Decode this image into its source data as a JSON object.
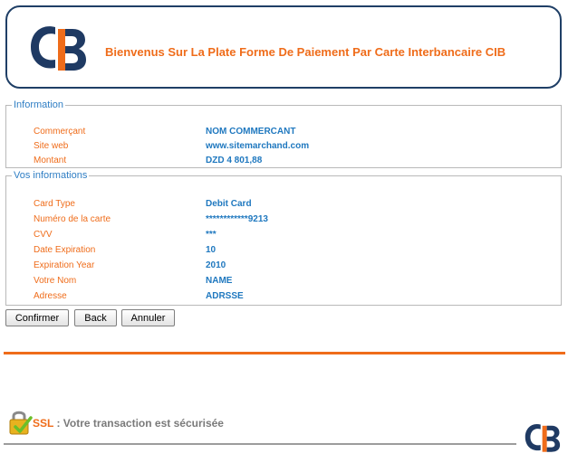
{
  "header": {
    "logo_text": "CIB",
    "welcome": "Bienvenus Sur La Plate Forme De Paiement Par Carte Interbancaire CIB"
  },
  "information": {
    "legend": "Information",
    "rows": [
      {
        "label": "Commerçant",
        "value": "NOM COMMERCANT"
      },
      {
        "label": "Site web",
        "value": "www.sitemarchand.com"
      },
      {
        "label": "Montant",
        "value": "DZD  4 801,88"
      }
    ]
  },
  "vos_informations": {
    "legend": "Vos informations",
    "rows": [
      {
        "label": "Card Type",
        "value": "Debit Card"
      },
      {
        "label": "Numéro de la carte",
        "value": "************9213"
      },
      {
        "label": "CVV",
        "value": "***"
      },
      {
        "label": "Date Expiration",
        "value": "10"
      },
      {
        "label": "Expiration Year",
        "value": "2010"
      },
      {
        "label": "Votre Nom",
        "value": "NAME"
      },
      {
        "label": "Adresse",
        "value": "ADRSSE"
      }
    ]
  },
  "buttons": {
    "confirm": "Confirmer",
    "back": "Back",
    "cancel": "Annuler"
  },
  "footer": {
    "ssl_label": "SSL",
    "ssl_message": " : Votre transaction est sécurisée",
    "logo_text": "CIB"
  },
  "colors": {
    "orange": "#ef6c1a",
    "blue_value": "#1f78bf",
    "legend_blue": "#2f7ec4",
    "header_border": "#1f3f66",
    "logo_navy": "#1f3a63"
  },
  "icons": {
    "lock": "padlock-with-checkmark-icon"
  }
}
